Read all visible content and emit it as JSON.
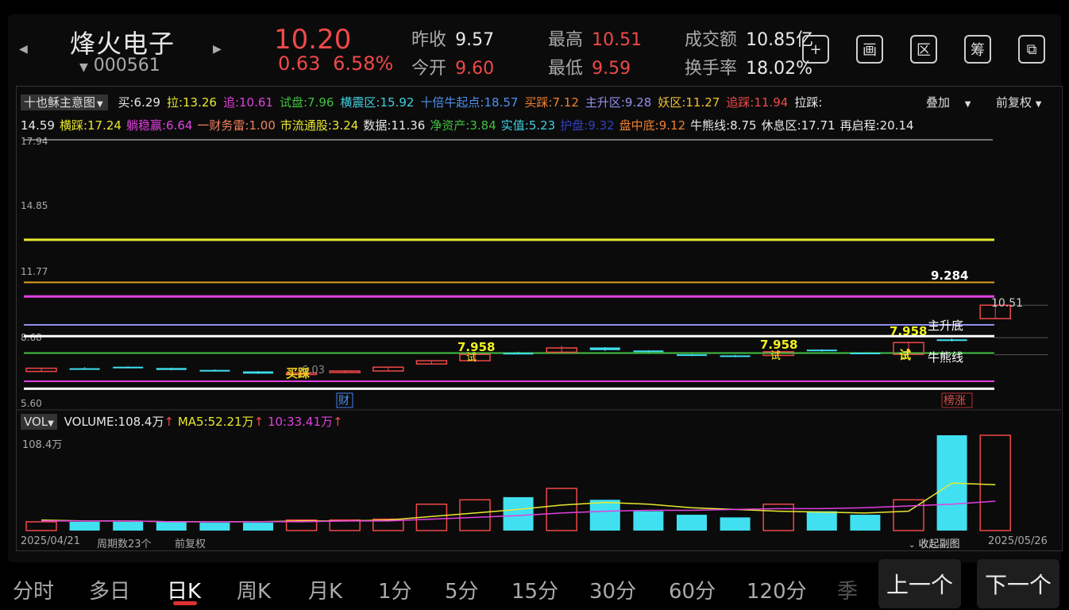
{
  "stock": {
    "name": "烽火电子",
    "code": "000561",
    "price": "10.20",
    "change": "0.63",
    "change_pct": "6.58%",
    "prev_close_label": "昨收",
    "prev_close": "9.57",
    "open_label": "今开",
    "open": "9.60",
    "high_label": "最高",
    "high": "10.51",
    "low_label": "最低",
    "low": "9.59",
    "turnover_label": "成交额",
    "turnover": "10.85亿",
    "turnover_rate_label": "换手率",
    "turnover_rate": "18.02%"
  },
  "tools": [
    {
      "label": "+",
      "icon": "add-watchlist-icon"
    },
    {
      "label": "画",
      "icon": "draw-icon"
    },
    {
      "label": "区",
      "icon": "range-icon"
    },
    {
      "label": "筹",
      "icon": "chips-icon"
    },
    {
      "label": "⧉",
      "icon": "switch-window-icon"
    }
  ],
  "indicator": {
    "name": "十也稣主意图",
    "overlay": "叠加",
    "adjust": "前复权",
    "items_row1": [
      {
        "text": "买:6.29",
        "color": "#e8e8e8"
      },
      {
        "text": "拉:13.26",
        "color": "#e8e830"
      },
      {
        "text": "追:10.61",
        "color": "#e040e0"
      },
      {
        "text": "试盘:7.96",
        "color": "#40c040"
      },
      {
        "text": "横震区:15.92",
        "color": "#40d0e0"
      },
      {
        "text": "十倍牛起点:18.57",
        "color": "#5090f0"
      },
      {
        "text": "买踩:7.12",
        "color": "#f08030"
      },
      {
        "text": "主升区:9.28",
        "color": "#9090f0"
      },
      {
        "text": "妖区:11.27",
        "color": "#f0c030"
      },
      {
        "text": "追踩:11.94",
        "color": "#f04848"
      },
      {
        "text": "拉踩:",
        "color": "#e8e8e8"
      }
    ],
    "items_row2": [
      {
        "text": "14.59",
        "color": "#e8e8e8"
      },
      {
        "text": "横踩:17.24",
        "color": "#e8e830"
      },
      {
        "text": "躺稳赢:6.64",
        "color": "#e040e0"
      },
      {
        "text": "一财务雷:1.00",
        "color": "#f08060"
      },
      {
        "text": "市流通股:3.24",
        "color": "#e8e830"
      },
      {
        "text": "数据:11.36",
        "color": "#e8e8e8"
      },
      {
        "text": "净资产:3.84",
        "color": "#40c040"
      },
      {
        "text": "实值:5.23",
        "color": "#40d0e0"
      },
      {
        "text": "护盘:9.32",
        "color": "#3040c0"
      },
      {
        "text": "盘中底:9.12",
        "color": "#f08030"
      },
      {
        "text": "牛熊线:8.75",
        "color": "#e8e8e8"
      },
      {
        "text": "休息区:17.71",
        "color": "#e8e8e8"
      },
      {
        "text": "再启程:20.14",
        "color": "#e8e8e8"
      }
    ]
  },
  "price_axis": [
    "17.94",
    "14.85",
    "11.77",
    "8.68",
    "5.60"
  ],
  "annotations": {
    "level_9284": "9.284",
    "high_label": "10.51",
    "main_rise_bottom": "主升底",
    "bull_bear_line": "牛熊线",
    "test1": "7.958",
    "test2": "7.958",
    "test3": "7.958",
    "test_char": "试",
    "buy_step": "买踩",
    "buy_val": "6.03",
    "finance": "财",
    "rank_up": "榜涨"
  },
  "volume": {
    "label": "VOL",
    "volume_text": "VOLUME:108.4万",
    "ma5_text": "MA5:52.21万",
    "ma10_text": "10:33.41万",
    "max_label": "108.4万"
  },
  "footer": {
    "start_date": "2025/04/21",
    "period_count": "周期数23个",
    "adjust": "前复权",
    "collapse": "收起副图",
    "end_date": "2025/05/26"
  },
  "tabs": [
    "分时",
    "多日",
    "日K",
    "周K",
    "月K",
    "1分",
    "5分",
    "15分",
    "30分",
    "60分",
    "120分",
    "季"
  ],
  "active_tab": "日K",
  "prev_button": "上一个",
  "next_button": "下一个",
  "chart_data": {
    "type": "candlestick",
    "ylim": [
      5.6,
      17.94
    ],
    "levels": [
      {
        "value": 13.26,
        "color": "#e8e830"
      },
      {
        "value": 11.27,
        "color": "#e0a020"
      },
      {
        "value": 10.61,
        "color": "#e040e0"
      },
      {
        "value": 9.28,
        "color": "#9090f0"
      },
      {
        "value": 8.75,
        "color": "#ffffff"
      },
      {
        "value": 7.96,
        "color": "#40c040"
      },
      {
        "value": 6.64,
        "color": "#e040e0"
      },
      {
        "value": 6.29,
        "color": "#ffffff"
      }
    ],
    "candles": [
      {
        "o": 7.1,
        "c": 7.25,
        "h": 7.25,
        "l": 7.1,
        "up": true
      },
      {
        "o": 7.25,
        "c": 7.25,
        "h": 7.3,
        "l": 7.2,
        "up": false
      },
      {
        "o": 7.32,
        "c": 7.26,
        "h": 7.34,
        "l": 7.24,
        "up": false
      },
      {
        "o": 7.26,
        "c": 7.17,
        "h": 7.28,
        "l": 7.15,
        "up": false
      },
      {
        "o": 7.17,
        "c": 7.14,
        "h": 7.2,
        "l": 7.1,
        "up": false
      },
      {
        "o": 7.1,
        "c": 7.0,
        "h": 7.12,
        "l": 6.98,
        "up": false
      },
      {
        "o": 7.0,
        "c": 7.03,
        "h": 7.05,
        "l": 6.98,
        "up": true
      },
      {
        "o": 7.05,
        "c": 7.12,
        "h": 7.15,
        "l": 7.03,
        "up": true
      },
      {
        "o": 7.12,
        "c": 7.3,
        "h": 7.32,
        "l": 7.1,
        "up": true
      },
      {
        "o": 7.45,
        "c": 7.6,
        "h": 7.62,
        "l": 7.44,
        "up": true
      },
      {
        "o": 7.6,
        "c": 7.9,
        "h": 7.96,
        "l": 7.58,
        "up": true
      },
      {
        "o": 7.97,
        "c": 7.96,
        "h": 8.02,
        "l": 7.93,
        "up": false
      },
      {
        "o": 8.0,
        "c": 8.2,
        "h": 8.3,
        "l": 7.98,
        "up": true
      },
      {
        "o": 8.22,
        "c": 8.1,
        "h": 8.24,
        "l": 8.05,
        "up": false
      },
      {
        "o": 8.08,
        "c": 8.02,
        "h": 8.1,
        "l": 7.98,
        "up": false
      },
      {
        "o": 7.9,
        "c": 7.85,
        "h": 7.92,
        "l": 7.82,
        "up": false
      },
      {
        "o": 7.85,
        "c": 7.8,
        "h": 7.88,
        "l": 7.76,
        "up": false
      },
      {
        "o": 7.85,
        "c": 8.02,
        "h": 8.04,
        "l": 7.84,
        "up": true
      },
      {
        "o": 8.12,
        "c": 8.05,
        "h": 8.14,
        "l": 8.02,
        "up": false
      },
      {
        "o": 7.98,
        "c": 7.95,
        "h": 8.0,
        "l": 7.92,
        "up": false
      },
      {
        "o": 7.9,
        "c": 8.45,
        "h": 8.5,
        "l": 7.88,
        "up": true
      },
      {
        "o": 8.6,
        "c": 8.55,
        "h": 8.65,
        "l": 8.5,
        "up": false
      },
      {
        "o": 9.57,
        "c": 10.2,
        "h": 10.51,
        "l": 9.59,
        "up": true
      }
    ],
    "volumes": [
      10,
      10,
      10,
      10,
      9,
      9,
      12,
      12,
      13,
      30,
      35,
      38,
      48,
      35,
      22,
      18,
      15,
      30,
      22,
      18,
      35,
      108.4,
      108.4
    ],
    "ma5": [
      12,
      11,
      11,
      10,
      10,
      10,
      11,
      11,
      12,
      16,
      20,
      24,
      29,
      32,
      30,
      26,
      24,
      22,
      21,
      20,
      22,
      54,
      52.21
    ],
    "ma10": [
      11,
      11,
      11,
      10,
      10,
      10,
      10,
      11,
      11,
      13,
      15,
      17,
      20,
      22,
      23,
      23,
      24,
      25,
      25,
      26,
      28,
      30,
      33.41
    ]
  }
}
